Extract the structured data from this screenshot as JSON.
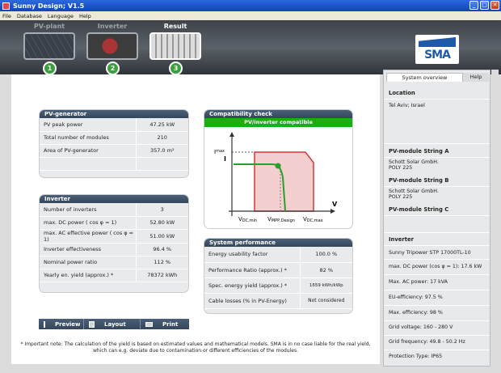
{
  "window": {
    "title": "Sunny Design; V1.5"
  },
  "menu": [
    "File",
    "Database",
    "Language",
    "Help"
  ],
  "steps": [
    {
      "label": "PV-plant",
      "number": "1",
      "active": false
    },
    {
      "label": "Inverter",
      "number": "2",
      "active": false
    },
    {
      "label": "Result",
      "number": "3",
      "active": true
    }
  ],
  "logo": "SMA",
  "pv_generator": {
    "title": "PV-generator",
    "rows": [
      {
        "label": "PV peak power",
        "value": "47.25 kW"
      },
      {
        "label": "Total number of modules",
        "value": "210"
      },
      {
        "label": "Area of PV-generator",
        "value": "357.0 m²"
      }
    ]
  },
  "inverter": {
    "title": "Inverter",
    "rows": [
      {
        "label": "Number of inverters",
        "value": "3"
      },
      {
        "label": "max. DC power ( cos φ = 1)",
        "value": "52.80 kW"
      },
      {
        "label": "max. AC effective power ( cos φ = 1)",
        "value": "51.00 kW"
      },
      {
        "label": "Inverter effectiveness",
        "value": "96.4 %"
      },
      {
        "label": "Nominal power ratio",
        "value": "112 %"
      },
      {
        "label": "Yearly en. yield (approx.) *",
        "value": "78372 kWh"
      }
    ]
  },
  "compat": {
    "title": "Compatibility check",
    "status": "PV/Inverter compatible",
    "axis_i": "I",
    "label_imax": "I",
    "label_imax_sub": "max",
    "axis_v": "V",
    "label_vmin": "V",
    "label_vmin_sub": "DC,min",
    "label_vmpp": "V",
    "label_vmpp_sub": "MPP,Design",
    "label_vmax": "V",
    "label_vmax_sub": "DC,max"
  },
  "performance": {
    "title": "System performance",
    "rows": [
      {
        "label": "Energy usability factor",
        "value": "100.0 %"
      },
      {
        "label": "Performance Ratio (approx.) *",
        "value": "82 %"
      },
      {
        "label": "Spec. energy yield (approx.) *",
        "value": "1659 kWh/kWp"
      },
      {
        "label": "Cable losses (% in PV-Energy)",
        "value": "Not considered"
      }
    ]
  },
  "toolbar": {
    "preview": "Preview",
    "layout": "Layout",
    "print": "Print"
  },
  "note": "* Important note: The calculation of the yield is based on estimated values and mathematical models. SMA is in no case liable for the real yield, which can e.g. deviate due to contamination or different efficiencies of the modules.",
  "sidebar": {
    "tab_overview": "System overview",
    "tab_help": "Help",
    "location_h": "Location",
    "location": "Tel Aviv; Israel",
    "stringA_h": "PV-module String A",
    "stringA_1": "Schott Solar GmbH.",
    "stringA_2": "POLY 225",
    "stringB_h": "PV-module String B",
    "stringB_1": "Schott Solar GmbH.",
    "stringB_2": "POLY 225",
    "stringC_h": "PV-module String C",
    "inverter_h": "Inverter",
    "inv_model": "Sunny Tripower STP 17000TL-10",
    "inv_dc": "max. DC power (cos φ = 1): 17.6 kW",
    "inv_ac": "Max. AC power: 17 kVA",
    "inv_eu": "EU-efficiency: 97.5 %",
    "inv_max": "Max. efficiency: 98 %",
    "inv_grid_v": "Grid voltage: 160 - 280 V",
    "inv_grid_f": "Grid frequency: 49.8 - 50.2 Hz",
    "inv_prot": "Protection Type: IP65"
  }
}
